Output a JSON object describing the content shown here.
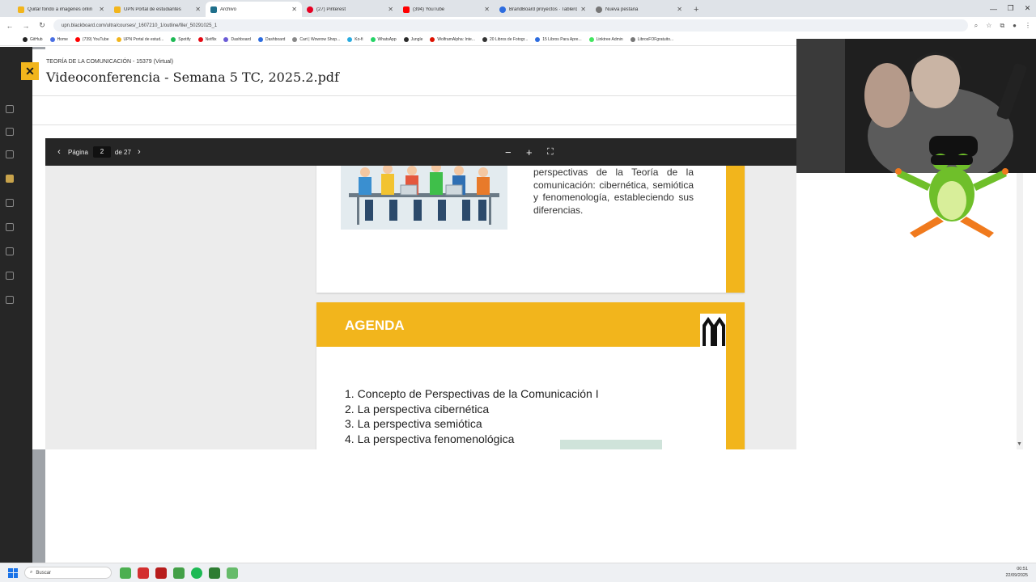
{
  "browser": {
    "tabs": [
      {
        "label": "Quitar fondo a imagenes onlin",
        "color": "#f2b51c"
      },
      {
        "label": "UPN Portal de estudiantes",
        "color": "#f2b51c"
      },
      {
        "label": "Archivo",
        "color": "#1f6f8b",
        "active": true
      },
      {
        "label": "(27) Pinterest",
        "color": "#e60023"
      },
      {
        "label": "(394) YouTube",
        "color": "#ff0000"
      },
      {
        "label": "BrandBoard proyectos · Tablero",
        "color": "#2d6cdf"
      },
      {
        "label": "Nueva pestaña",
        "color": "#777777"
      }
    ],
    "url": "upn.blackboard.com/ultra/courses/_1607210_1/outline/file/_50291025_1",
    "bookmarks": [
      {
        "label": "GitHub",
        "color": "#222222"
      },
      {
        "label": "Home",
        "color": "#4a6fe3"
      },
      {
        "label": "(739) YouTube",
        "color": "#ff0000"
      },
      {
        "label": "UPN Portal de estud...",
        "color": "#f2b51c"
      },
      {
        "label": "Spotify",
        "color": "#1db954"
      },
      {
        "label": "Netflix",
        "color": "#e50914"
      },
      {
        "label": "Dashboard",
        "color": "#6b5bd6"
      },
      {
        "label": "Dashboard",
        "color": "#2d6cdf"
      },
      {
        "label": "Cart | Wowrow Shop...",
        "color": "#888888"
      },
      {
        "label": "Ko-fi",
        "color": "#29abe0"
      },
      {
        "label": "WhatsApp",
        "color": "#25d366"
      },
      {
        "label": "Jungle",
        "color": "#2b2b2b"
      },
      {
        "label": "WolframAlpha: Inte...",
        "color": "#dd1100"
      },
      {
        "label": "20 Libros de Fotogr...",
        "color": "#333333"
      },
      {
        "label": "15 Libros Para Apre...",
        "color": "#2d6cdf"
      },
      {
        "label": "Linktree Admin",
        "color": "#43e660"
      },
      {
        "label": "LibrosFOFgratuito...",
        "color": "#777777"
      }
    ]
  },
  "viewer": {
    "course": "TEORÍA DE LA COMUNICACIÓN - 15379 (Virtual)",
    "title": "Videoconferencia - Semana 5 TC, 2025.2.pdf",
    "toolbar": {
      "page_label": "Página",
      "page_value": "2",
      "of_label": "de 27"
    }
  },
  "slide1": {
    "text": "perspectivas de la Teoría de la comunicación: cibernética, semiótica y fenomenología, estableciendo sus diferencias."
  },
  "slide2": {
    "heading": "AGENDA",
    "items": [
      "1. Concepto de Perspectivas de la Comunicación I",
      "2. La perspectiva cibernética",
      "3. La perspectiva semiótica",
      "4. La perspectiva fenomenológica"
    ]
  },
  "taskbar": {
    "search_placeholder": "Buscar",
    "time": "00:51",
    "date": "22/09/2025"
  },
  "colors": {
    "accent": "#f2b51c",
    "toolbar": "#262626"
  }
}
